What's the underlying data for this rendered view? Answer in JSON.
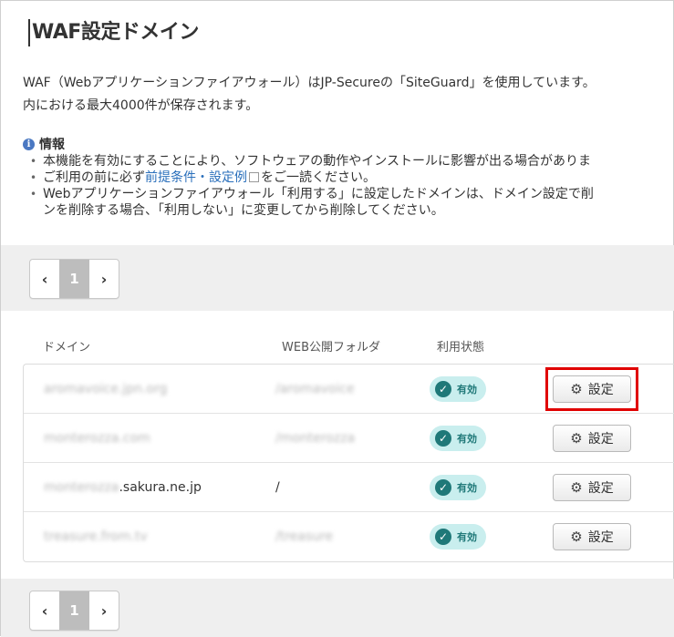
{
  "page_title": "WAF設定ドメイン",
  "description": {
    "line1": "WAF（Webアプリケーションファイアウォール）はJP-Secureの「SiteGuard」を使用しています。",
    "line2": "内における最大4000件が保存されます。"
  },
  "info": {
    "heading": "情報",
    "note1": "本機能を有効にすることにより、ソフトウェアの動作やインストールに影響が出る場合がありま",
    "note2_before": "ご利用の前に必ず",
    "note2_link": "前提条件・設定例",
    "note2_after": "をご一読ください。",
    "note3_line1": "Webアプリケーションファイアウォール「利用する」に設定したドメインは、ドメイン設定で削",
    "note3_line2": "ンを削除する場合、「利用しない」に変更してから削除してください。"
  },
  "pagination": {
    "current": "1",
    "prev": "‹",
    "next": "›"
  },
  "columns": {
    "domain": "ドメイン",
    "folder": "WEB公開フォルダ",
    "status": "利用状態"
  },
  "rows": [
    {
      "domain": "aromavoice.jpn.org",
      "folder": "/aromavoice",
      "status": "有効",
      "action": "設定"
    },
    {
      "domain": "monterozza.com",
      "folder": "/monterozza",
      "status": "有効",
      "action": "設定"
    },
    {
      "domain_blurred": "monterozza",
      "domain_suffix": ".sakura.ne.jp",
      "folder": "/",
      "status": "有効",
      "action": "設定"
    },
    {
      "domain": "treasure.from.tv",
      "folder": "/treasure",
      "status": "有効",
      "action": "設定"
    }
  ],
  "icons": {
    "info": "info-icon",
    "check": "check-icon",
    "gear": "gear-icon",
    "external": "external-link-icon"
  },
  "colors": {
    "badge_bg": "#c9eeee",
    "badge_fg": "#1f7878",
    "highlight": "#e00000",
    "link": "#2a6fbb"
  }
}
